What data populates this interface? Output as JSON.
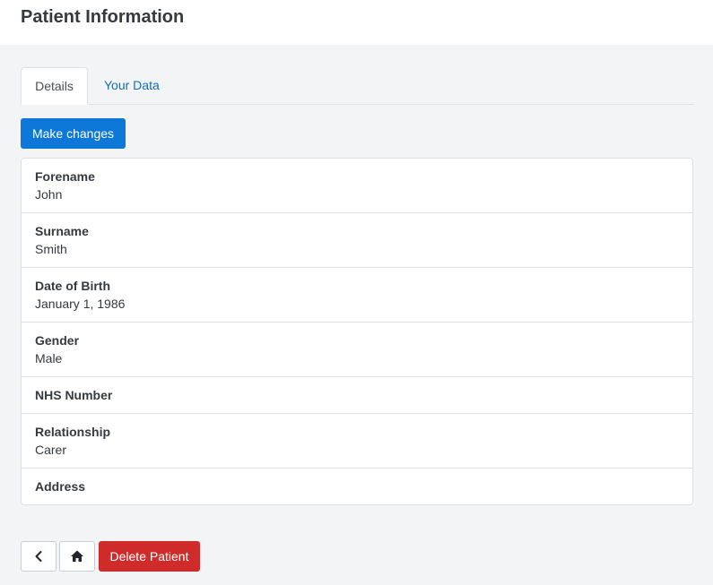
{
  "header": {
    "title": "Patient Information"
  },
  "tabs": [
    {
      "label": "Details",
      "active": true
    },
    {
      "label": "Your Data",
      "active": false
    }
  ],
  "actions": {
    "edit_label": "Make changes"
  },
  "patient": {
    "fields": [
      {
        "label": "Forename",
        "value": "John"
      },
      {
        "label": "Surname",
        "value": "Smith"
      },
      {
        "label": "Date of Birth",
        "value": "January 1, 1986"
      },
      {
        "label": "Gender",
        "value": "Male"
      },
      {
        "label": "NHS Number",
        "value": ""
      },
      {
        "label": "Relationship",
        "value": "Carer"
      },
      {
        "label": "Address",
        "value": ""
      }
    ]
  },
  "footer": {
    "back_icon": "chevron-left-icon",
    "home_icon": "home-icon",
    "delete_label": "Delete Patient"
  },
  "colors": {
    "primary": "#0d78d8",
    "link": "#0d6ec4",
    "danger": "#d02b2b",
    "background": "#f3f4f6"
  }
}
